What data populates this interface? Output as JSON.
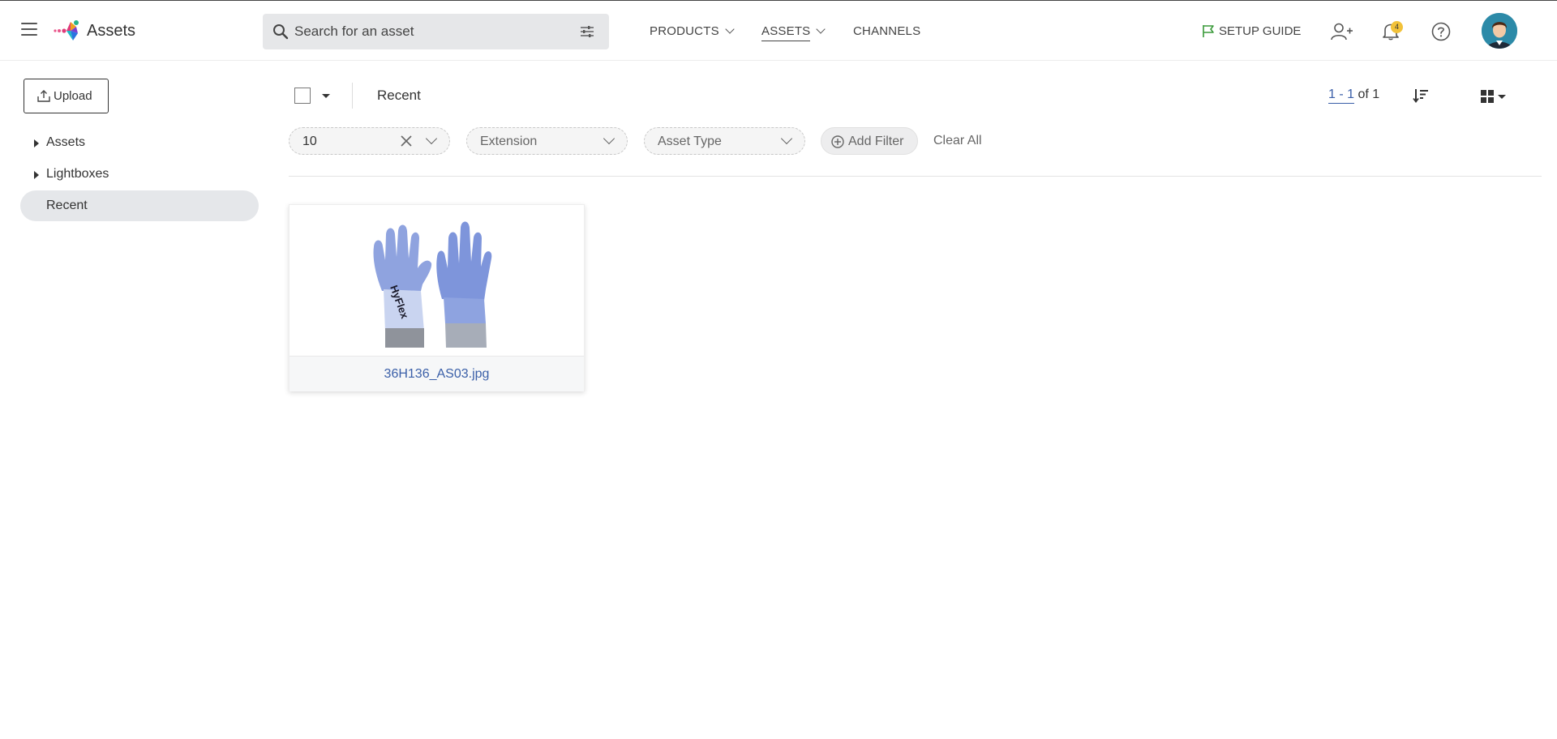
{
  "header": {
    "app_title": "Assets",
    "search": {
      "placeholder": "Search for an asset"
    },
    "nav": [
      {
        "label": "PRODUCTS",
        "has_dropdown": true,
        "active": false
      },
      {
        "label": "ASSETS",
        "has_dropdown": true,
        "active": true
      },
      {
        "label": "CHANNELS",
        "has_dropdown": false,
        "active": false
      }
    ],
    "setup_guide": "SETUP GUIDE",
    "notifications_count": "4",
    "colors": {
      "accent": "#3a5fa8",
      "badge": "#f2c23a",
      "setup_flag": "#3a9a3a"
    },
    "icons": [
      "menu-icon",
      "logo-icon",
      "search-icon",
      "tune-icon",
      "flag-icon",
      "add-user-icon",
      "bell-icon",
      "help-icon",
      "avatar"
    ]
  },
  "sidebar": {
    "upload_label": "Upload",
    "items": [
      {
        "label": "Assets",
        "expandable": true,
        "selected": false
      },
      {
        "label": "Lightboxes",
        "expandable": true,
        "selected": false
      },
      {
        "label": "Recent",
        "expandable": false,
        "selected": true
      }
    ]
  },
  "toolbar": {
    "breadcrumb": "Recent",
    "paging_range": "1 - 1",
    "paging_total": "of 1"
  },
  "filters": [
    {
      "label": "10",
      "clearable": true
    },
    {
      "label": "Extension",
      "clearable": false
    },
    {
      "label": "Asset Type",
      "clearable": false
    }
  ],
  "add_filter_label": "Add Filter",
  "clear_all_label": "Clear All",
  "assets": [
    {
      "filename": "36H136_AS03.jpg",
      "thumbnail": "gloves-image"
    }
  ]
}
